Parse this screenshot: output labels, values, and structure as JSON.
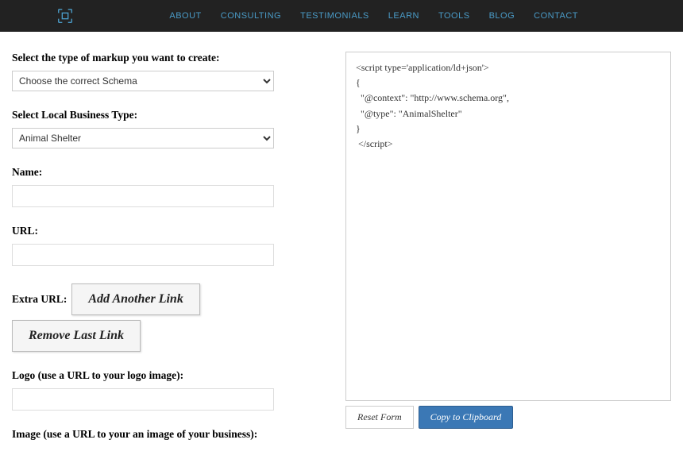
{
  "nav": {
    "items": [
      {
        "label": "ABOUT"
      },
      {
        "label": "CONSULTING"
      },
      {
        "label": "TESTIMONIALS"
      },
      {
        "label": "LEARN"
      },
      {
        "label": "TOOLS"
      },
      {
        "label": "BLOG"
      },
      {
        "label": "CONTACT"
      }
    ]
  },
  "form": {
    "markup_type_label": "Select the type of markup you want to create:",
    "markup_type_value": "Choose the correct Schema",
    "business_type_label": "Select Local Business Type:",
    "business_type_value": "Animal Shelter",
    "name_label": "Name:",
    "name_value": "",
    "url_label": "URL:",
    "url_value": "",
    "extra_url_label": "Extra URL:",
    "add_link_label": "Add Another Link",
    "remove_link_label": "Remove Last Link",
    "logo_label": "Logo (use a URL to your logo image):",
    "logo_value": "",
    "image_label": "Image (use a URL to your an image of your business):"
  },
  "output": {
    "code": "<script type='application/ld+json'>\n{\n  \"@context\": \"http://www.schema.org\",\n  \"@type\": \"AnimalShelter\"\n}\n </script>",
    "reset_label": "Reset Form",
    "copy_label": "Copy to Clipboard"
  }
}
